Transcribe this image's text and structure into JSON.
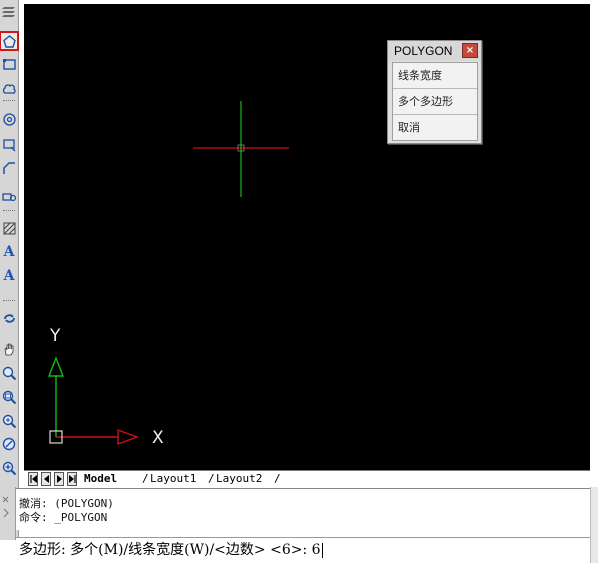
{
  "popup": {
    "title": "POLYGON",
    "close": "×",
    "items": [
      "线条宽度",
      "多个多边形",
      "取消"
    ]
  },
  "canvas": {
    "background": "#000000",
    "ucs": {
      "x_label": "X",
      "y_label": "Y",
      "x_color": "#cc1111",
      "y_color": "#11bb11"
    },
    "crosshair": {
      "h_color": "#cc1111",
      "v_color": "#11bb11"
    }
  },
  "tabs": {
    "items": [
      "Model",
      "Layout1",
      "Layout2"
    ],
    "active": "Model"
  },
  "command": {
    "history": [
      "撤消: (POLYGON)",
      "命令: _POLYGON"
    ],
    "prompt": "多边形: 多个(M)/线条宽度(W)/<边数> <6>: 6"
  },
  "toolbar": {
    "icons": [
      "layer-icon",
      "polygon-icon",
      "rectangle-icon",
      "revcloud-icon",
      "circle-icon",
      "insert-icon",
      "polyline-icon",
      "block-icon",
      "hatch-icon",
      "text-icon",
      "mtext-icon",
      "undo-redo-icon",
      "pan-icon",
      "zoom-realtime-icon",
      "zoom-window-icon",
      "zoom-extents-icon",
      "zoom-previous-icon",
      "zoom-in-icon"
    ],
    "active": "polygon-icon",
    "text_letters": {
      "text": "A",
      "mtext": "A"
    }
  }
}
